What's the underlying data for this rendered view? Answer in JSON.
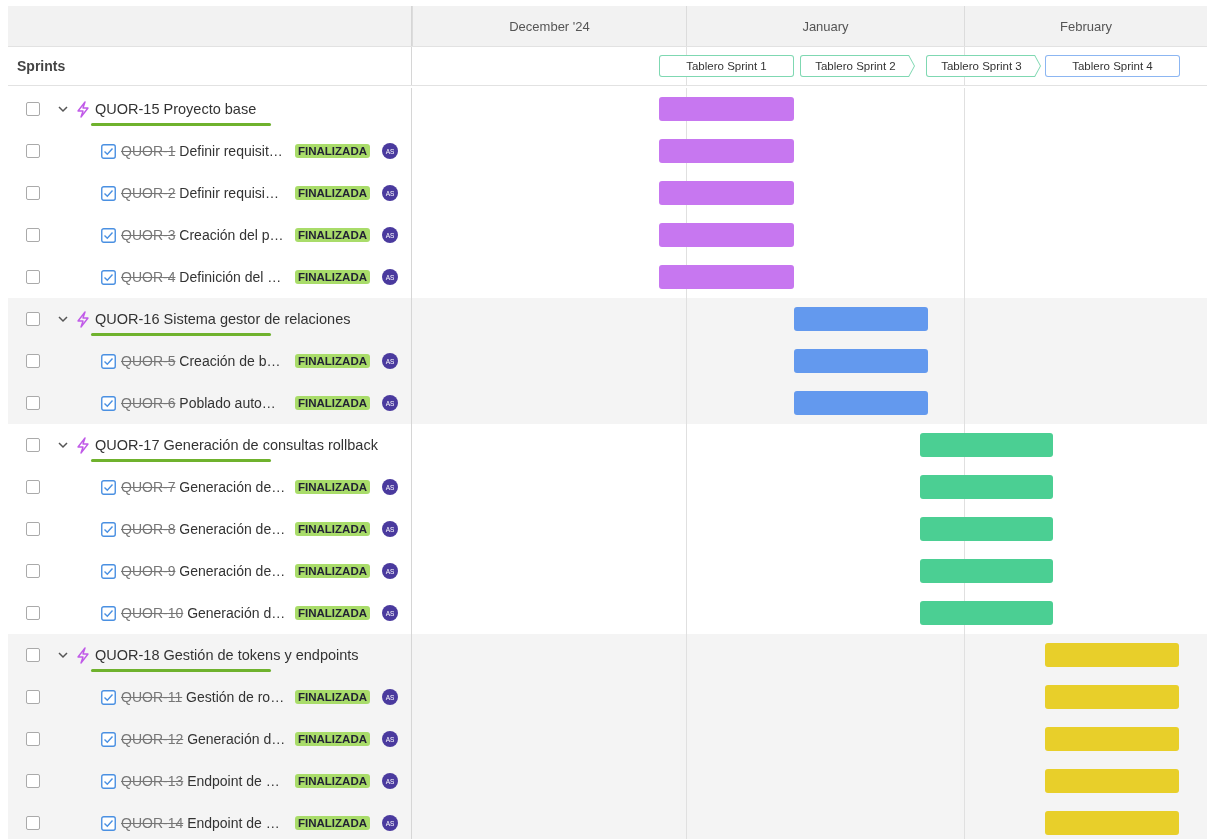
{
  "timeline": {
    "months": [
      "December '24",
      "January",
      "February"
    ]
  },
  "sprints_header": "Sprints",
  "sprints": [
    {
      "label": "Tablero Sprint 1",
      "kind": "plain",
      "color": "#7fd8b2"
    },
    {
      "label": "Tablero Sprint 2",
      "kind": "arrow",
      "color": "#7fd8b2"
    },
    {
      "label": "Tablero Sprint 3",
      "kind": "arrow",
      "color": "#7fd8b2"
    },
    {
      "label": "Tablero Sprint 4",
      "kind": "plain",
      "color": "#8cb6f2"
    }
  ],
  "epics": [
    {
      "key": "QUOR-15",
      "title": "Proyecto base",
      "checked": false,
      "expanded": true,
      "color": "#c777f0",
      "progress": {
        "level": 1
      },
      "tasks": [
        {
          "key": "QUOR-1",
          "title": "Definir requisit…",
          "checked": false,
          "done": true,
          "status": "FINALIZADA",
          "assignee": "AS"
        },
        {
          "key": "QUOR-2",
          "title": "Definir requisi…",
          "checked": false,
          "done": true,
          "status": "FINALIZADA",
          "assignee": "AS"
        },
        {
          "key": "QUOR-3",
          "title": "Creación del p…",
          "checked": false,
          "done": true,
          "status": "FINALIZADA",
          "assignee": "AS"
        },
        {
          "key": "QUOR-4",
          "title": "Definición del …",
          "checked": false,
          "done": true,
          "status": "FINALIZADA",
          "assignee": "AS"
        }
      ]
    },
    {
      "key": "QUOR-16",
      "title": "Sistema gestor de relaciones",
      "checked": false,
      "expanded": true,
      "color": "#6399ee",
      "progress": {
        "level": 1
      },
      "tasks": [
        {
          "key": "QUOR-5",
          "title": "Creación de b…",
          "checked": false,
          "done": true,
          "status": "FINALIZADA",
          "assignee": "AS"
        },
        {
          "key": "QUOR-6",
          "title": "Poblado auto…",
          "checked": false,
          "done": true,
          "status": "FINALIZADA",
          "assignee": "AS"
        }
      ]
    },
    {
      "key": "QUOR-17",
      "title": "Generación de consultas rollback",
      "checked": false,
      "expanded": true,
      "color": "#4bcf93",
      "progress": {
        "level": 1
      },
      "tasks": [
        {
          "key": "QUOR-7",
          "title": "Generación de…",
          "checked": false,
          "done": true,
          "status": "FINALIZADA",
          "assignee": "AS"
        },
        {
          "key": "QUOR-8",
          "title": "Generación de…",
          "checked": false,
          "done": true,
          "status": "FINALIZADA",
          "assignee": "AS"
        },
        {
          "key": "QUOR-9",
          "title": "Generación de…",
          "checked": false,
          "done": true,
          "status": "FINALIZADA",
          "assignee": "AS"
        },
        {
          "key": "QUOR-10",
          "title": "Generación d…",
          "checked": false,
          "done": true,
          "status": "FINALIZADA",
          "assignee": "AS"
        }
      ]
    },
    {
      "key": "QUOR-18",
      "title": "Gestión de tokens y endpoints",
      "checked": false,
      "expanded": true,
      "color": "#e8cf2a",
      "progress": {
        "level": 1
      },
      "tasks": [
        {
          "key": "QUOR-11",
          "title": "Gestión de ro…",
          "checked": false,
          "done": true,
          "status": "FINALIZADA",
          "assignee": "AS"
        },
        {
          "key": "QUOR-12",
          "title": "Generación d…",
          "checked": false,
          "done": true,
          "status": "FINALIZADA",
          "assignee": "AS"
        },
        {
          "key": "QUOR-13",
          "title": "Endpoint de …",
          "checked": false,
          "done": true,
          "status": "FINALIZADA",
          "assignee": "AS"
        },
        {
          "key": "QUOR-14",
          "title": "Endpoint de …",
          "checked": false,
          "done": true,
          "status": "FINALIZADA",
          "assignee": "AS"
        }
      ]
    }
  ]
}
